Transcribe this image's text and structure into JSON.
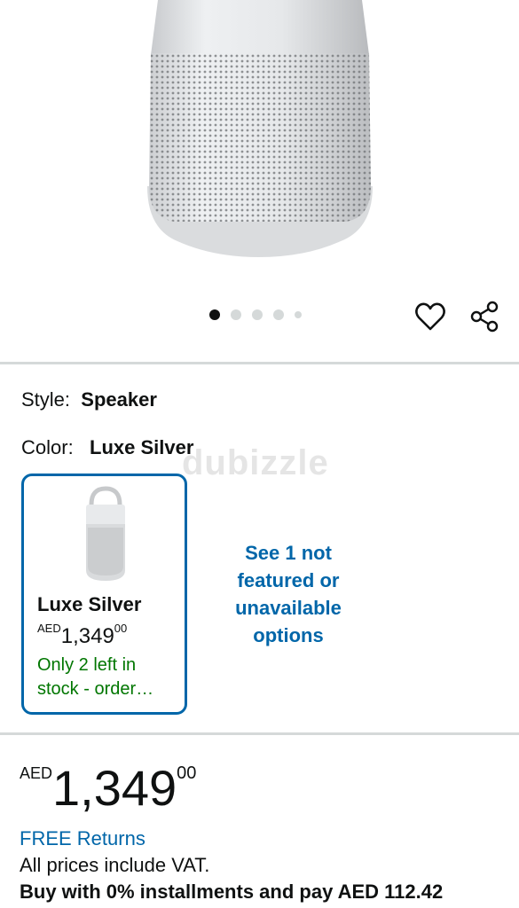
{
  "product_image": {
    "alt_icon": "speaker-image",
    "body_color": "#e3e4e6"
  },
  "carousel": {
    "total": 5,
    "active_index": 0
  },
  "actions": {
    "wishlist_icon": "heart-icon",
    "share_icon": "share-icon"
  },
  "style": {
    "label": "Style:",
    "value": "Speaker"
  },
  "color": {
    "label": "Color:",
    "value": "Luxe Silver"
  },
  "watermark": "dubizzle",
  "swatch": {
    "name": "Luxe Silver",
    "currency": "AED",
    "price_whole": "1,349",
    "price_fraction": "00",
    "stock_note": "Only 2 left in stock - order…",
    "selected": true
  },
  "see_options": "See 1 not featured or unavailable options",
  "price": {
    "currency": "AED",
    "whole": "1,349",
    "fraction": "00"
  },
  "free_returns": "FREE Returns",
  "vat_note": "All prices include VAT.",
  "installments": "Buy with 0% installments and pay AED 112.42",
  "colors": {
    "link": "#0066a9",
    "stock": "#007600",
    "divider": "#d5d9d9"
  }
}
